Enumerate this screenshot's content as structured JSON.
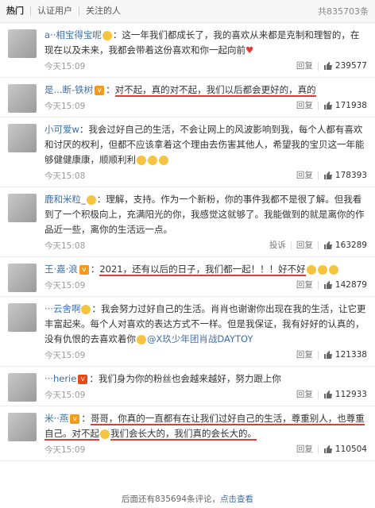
{
  "tabs": [
    {
      "label": "热门"
    },
    {
      "label": "认证用户"
    },
    {
      "label": "关注的人"
    }
  ],
  "total_count": "共835703条",
  "comments": [
    {
      "user": "a··相宝得宝呢",
      "user_suffix": "",
      "text": "这一年我们都成长了，我的喜欢从来都是克制和理智的，在现在以及未来，我都会带着这份喜欢和你一起向前",
      "time": "今天15:09",
      "actions": [
        "回复"
      ],
      "likes": "239577"
    },
    {
      "user": "是...断-铁树",
      "text": "对不起，真的对不起，我们以后都会更好的，真的",
      "time": "今天15:09",
      "actions": [
        "回复"
      ],
      "likes": "171938"
    },
    {
      "user": "小可爱w",
      "text": "我会过好自己的生活，不会让网上的风波影响到我，每个人都有喜欢和讨厌的权利，但都不应该拿着这个理由去伤害其他人，希望我的宝贝这一年能够健健康康，顺顺利利",
      "time": "今天15:08",
      "actions": [
        "回复"
      ],
      "likes": "178393"
    },
    {
      "user": "鹿和米粒_",
      "text": "理解，支持。作为一个新粉，你的事件我都不是很了解。但我看到了一个积极向上，充满阳光的你，我感觉这就够了。我能做到的就是离你的作品近一些，离你的生活远一点。",
      "time": "今天15:08",
      "actions": [
        "投诉",
        "回复"
      ],
      "likes": "163289"
    },
    {
      "user": "王·嘉·浪",
      "text": "2021，还有以后的日子，我们都一起！！！好不好",
      "time": "今天15:09",
      "actions": [
        "回复"
      ],
      "likes": "142879"
    },
    {
      "user": "···云舍啊",
      "text": "我会努力过好自己的生活。肖肖也谢谢你出现在我的生活，让它更丰富起来。每个人对喜欢的表达方式不一样。但是我保证，我有好好的认真的，没有仇恨的去喜欢着你",
      "mention": "@X玖少年团肖战DAYTOY",
      "time": "今天15:09",
      "actions": [
        "回复"
      ],
      "likes": "121338"
    },
    {
      "user": "···herie",
      "text": "我们身为你的粉丝也会越来越好，努力跟上你",
      "time": "今天15:09",
      "actions": [
        "回复"
      ],
      "likes": "112933"
    },
    {
      "user": "米··燕",
      "text": "哥哥，你真的一直都有在让我们过好自己的生活，尊重别人，也尊重自己。对不起",
      "text2": "我们会长大的，我们真的会长大的。",
      "time": "今天15:09",
      "actions": [
        "回复"
      ],
      "likes": "110504"
    }
  ],
  "footer": {
    "prefix": "后面还有835694条评论，",
    "link": "点击查看"
  },
  "icons": {
    "like": "thumb-up-icon",
    "vip": "vip-badge-icon"
  }
}
